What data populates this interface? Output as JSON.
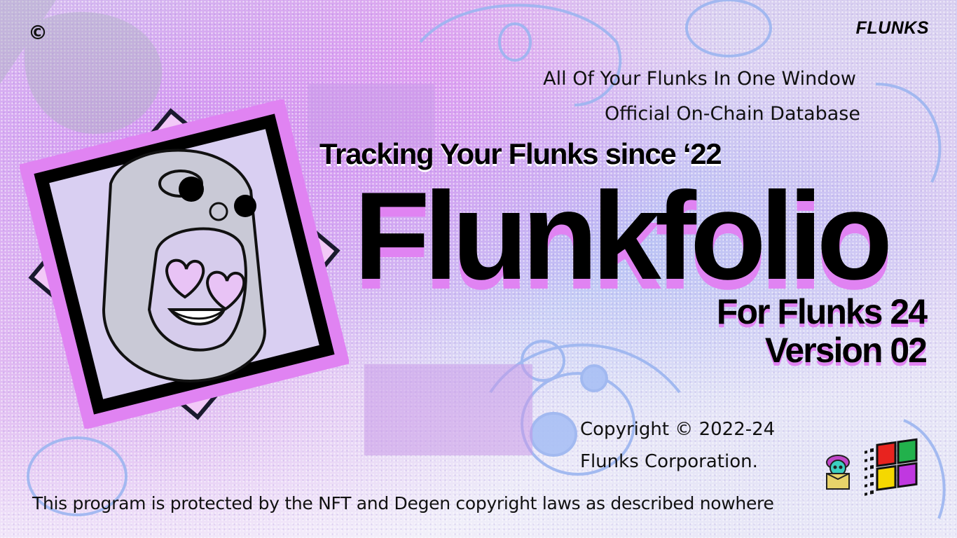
{
  "brand": "FLUNKS",
  "icons": {
    "corner": "copyright-icon",
    "mascot": "heart-eyes-mascot",
    "box": "gift-box-character-icon",
    "logo": "windows-flag-logo"
  },
  "taglines": [
    "All Of Your Flunks In One Window",
    "Official On-Chain Database"
  ],
  "tracking": "Tracking Your Flunks since ‘22",
  "title": "Flunkfolio",
  "edition": "For Flunks 24",
  "version": "Version 02",
  "copyright": [
    "Copyright © 2022-24",
    "Flunks Corporation."
  ],
  "footer": "This program is protected by the NFT and Degen copyright laws as described nowhere",
  "colors": {
    "accent_pink": "#e083f2",
    "accent_blue": "#9bb5f0",
    "text": "#000000"
  }
}
